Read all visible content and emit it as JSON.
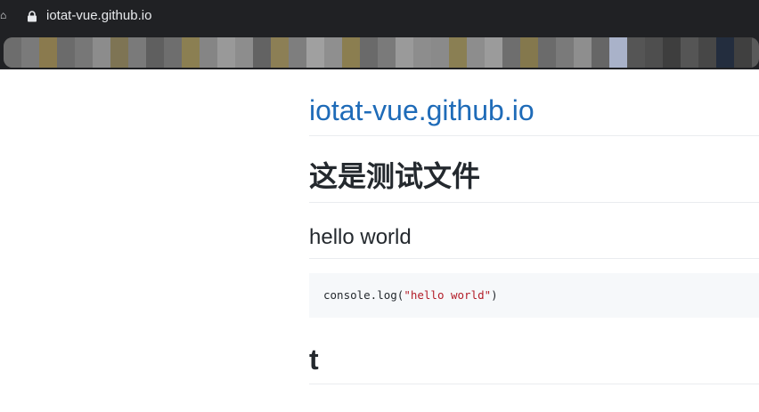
{
  "browser": {
    "url": "iotat-vue.github.io",
    "lock_icon": "lock-icon",
    "nav_icon": "home-icon",
    "bookmarks_blurred": true
  },
  "page": {
    "site_title": "iotat-vue.github.io",
    "heading_1": "这是测试文件",
    "heading_2": "hello world",
    "code": {
      "prefix": "console.log(",
      "string": "\"hello world\"",
      "suffix": ")"
    },
    "heading_3": "t"
  },
  "colors": {
    "browser_bar": "#202124",
    "link": "#1e6bb8",
    "heading_text": "#24292e",
    "code_bg": "#f6f8fa",
    "code_string": "#b31d28",
    "divider": "#eaecef"
  }
}
